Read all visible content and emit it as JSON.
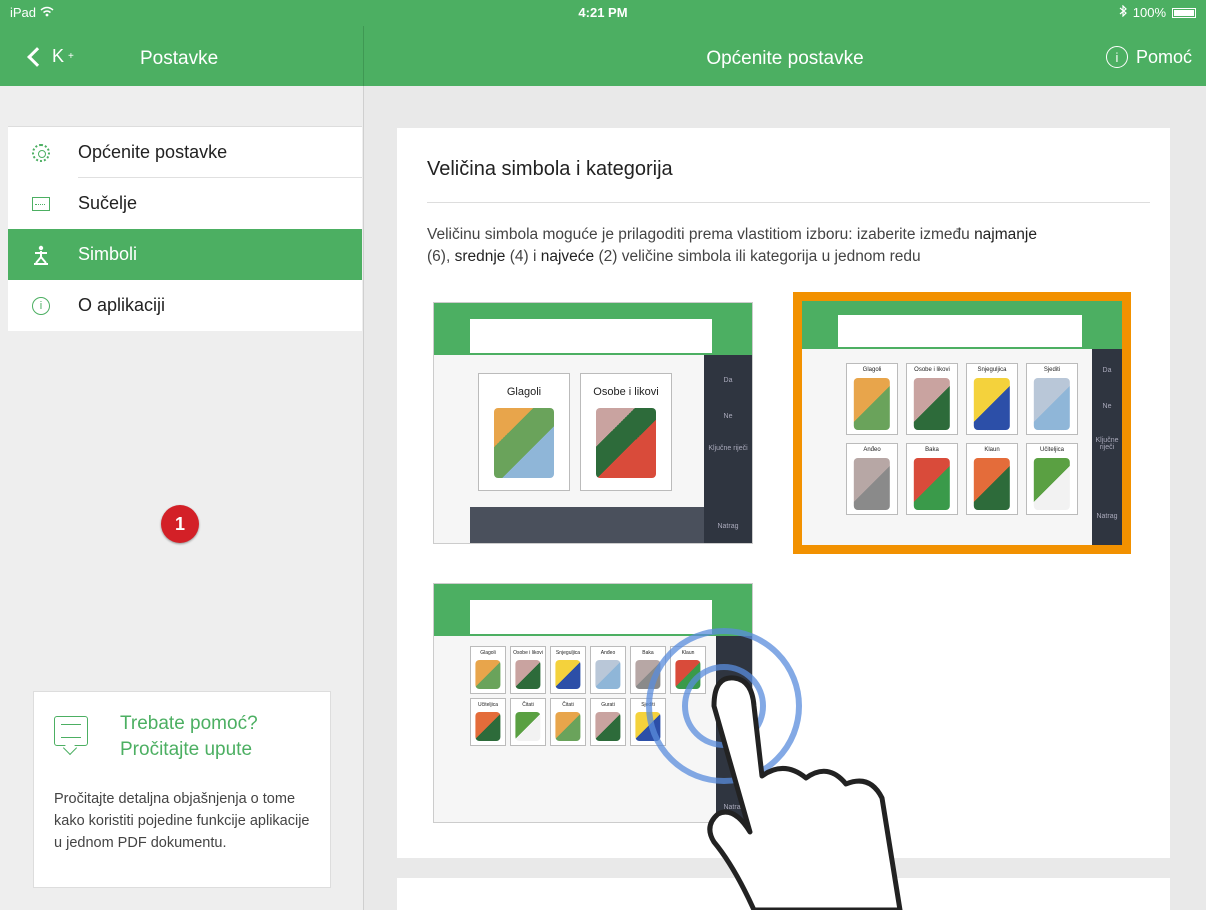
{
  "status": {
    "device": "iPad",
    "time": "4:21 PM",
    "battery": "100%"
  },
  "nav": {
    "back_label": "K",
    "back_sup": "+",
    "left_title": "Postavke",
    "right_title": "Općenite postavke",
    "help_label": "Pomoć"
  },
  "sidebar": {
    "items": [
      {
        "label": "Općenite postavke",
        "icon": "gear-icon",
        "selected": false
      },
      {
        "label": "Sučelje",
        "icon": "interface-icon",
        "selected": false
      },
      {
        "label": "Simboli",
        "icon": "symbols-icon",
        "selected": true
      },
      {
        "label": "O aplikaciji",
        "icon": "info-icon",
        "selected": false
      }
    ],
    "badge": "1",
    "help": {
      "title_line1": "Trebate pomoć?",
      "title_line2": "Pročitajte upute",
      "text": "Pročitajte detaljna objašnjenja o tome kako koristiti pojedine funkcije aplikacije u jednom PDF dokumentu."
    }
  },
  "main": {
    "section_title": "Veličina simbola i kategorija",
    "desc_1": "Veličinu simbola moguće je prilagoditi prema vlastitiom izboru: izaberite između ",
    "desc_b1": "najmanje",
    "desc_2": "(6), ",
    "desc_b2": "srednje",
    "desc_3": " (4) i ",
    "desc_b3": "najveće",
    "desc_4": " (2) veličine simbola ili kategorija u jednom redu",
    "preview_large": {
      "tiles": [
        "Glagoli",
        "Osobe i likovi"
      ],
      "side": [
        "Da",
        "Ne",
        "Ključne riječi",
        "Natrag"
      ]
    },
    "preview_medium": {
      "tiles": [
        "Glagoli",
        "Osobe i likovi",
        "Snjeguljica",
        "Sjediti",
        "Anđeo",
        "Baka",
        "Klaun",
        "Učiteljica"
      ],
      "side": [
        "Da",
        "Ne",
        "Ključne riječi",
        "Natrag"
      ],
      "selected": true
    },
    "preview_small": {
      "tiles": [
        "Glagoli",
        "Osobe i likovi",
        "Snjeguljica",
        "Anđeo",
        "Baka",
        "Klaun",
        "Učiteljica",
        "Čitati",
        "Čitati",
        "Gurati",
        "Sjediti"
      ],
      "side": [
        "Natrag"
      ]
    }
  },
  "colors": {
    "accent": "#4caf62",
    "selected_frame": "#f29100",
    "badge": "#d32027"
  }
}
